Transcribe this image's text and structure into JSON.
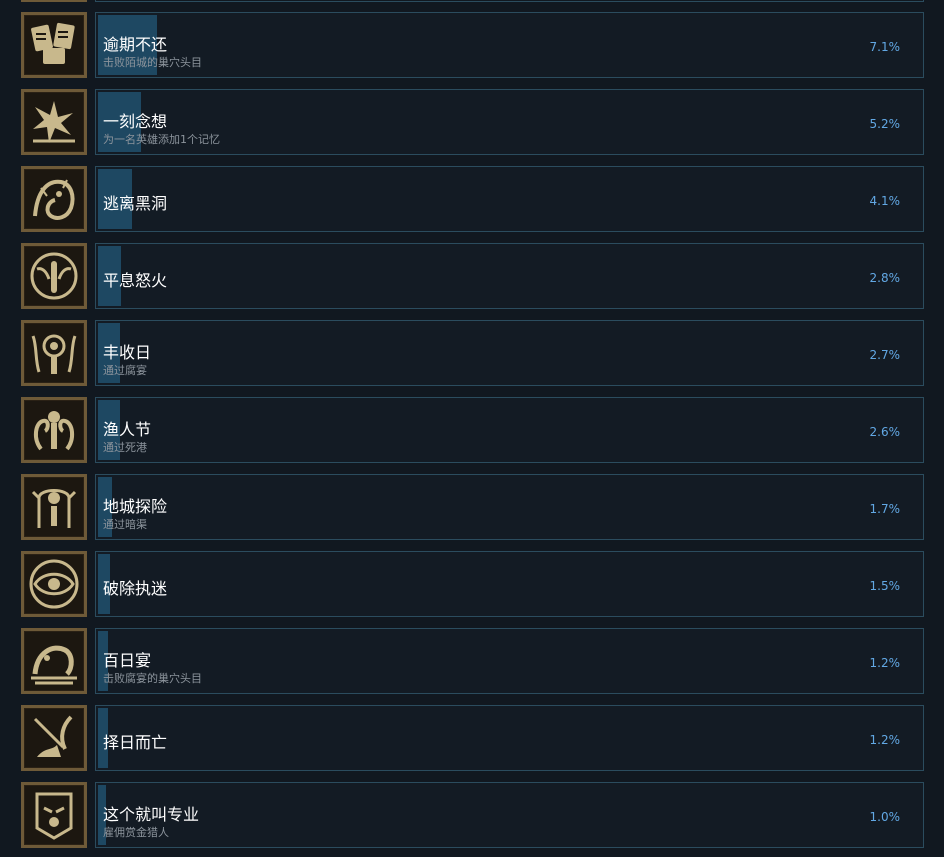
{
  "achievements": [
    {
      "title": "逾期不还",
      "desc": "击败陌城的巢穴头目",
      "percent": "7.1%",
      "value": 7.1,
      "icon": "scrolls-icon"
    },
    {
      "title": "一刻念想",
      "desc": "为一名英雄添加1个记忆",
      "percent": "5.2%",
      "value": 5.2,
      "icon": "memory-burst-icon"
    },
    {
      "title": "逃离黑洞",
      "desc": "",
      "percent": "4.1%",
      "value": 4.1,
      "icon": "monster-face-icon"
    },
    {
      "title": "平息怒火",
      "desc": "",
      "percent": "2.8%",
      "value": 2.8,
      "icon": "calm-figure-icon"
    },
    {
      "title": "丰收日",
      "desc": "通过腐宴",
      "percent": "2.7%",
      "value": 2.7,
      "icon": "harvest-eye-icon"
    },
    {
      "title": "渔人节",
      "desc": "通过死港",
      "percent": "2.6%",
      "value": 2.6,
      "icon": "tentacles-icon"
    },
    {
      "title": "地城探险",
      "desc": "通过暗渠",
      "percent": "1.7%",
      "value": 1.7,
      "icon": "dungeon-totem-icon"
    },
    {
      "title": "破除执迷",
      "desc": "",
      "percent": "1.5%",
      "value": 1.5,
      "icon": "eye-icon"
    },
    {
      "title": "百日宴",
      "desc": "击败腐宴的巢穴头目",
      "percent": "1.2%",
      "value": 1.2,
      "icon": "beast-icon"
    },
    {
      "title": "择日而亡",
      "desc": "",
      "percent": "1.2%",
      "value": 1.2,
      "icon": "fallen-blade-icon"
    },
    {
      "title": "这个就叫专业",
      "desc": "雇佣赏金猎人",
      "percent": "1.0%",
      "value": 1.0,
      "icon": "bounty-mask-icon"
    }
  ],
  "colors": {
    "background": "#111820",
    "panel_border": "#2b4c5e",
    "progress_fill": "#1e4862",
    "percent_text": "#62a8e4",
    "icon_frame": "#6e5a38",
    "icon_art": "#c8b88c"
  }
}
